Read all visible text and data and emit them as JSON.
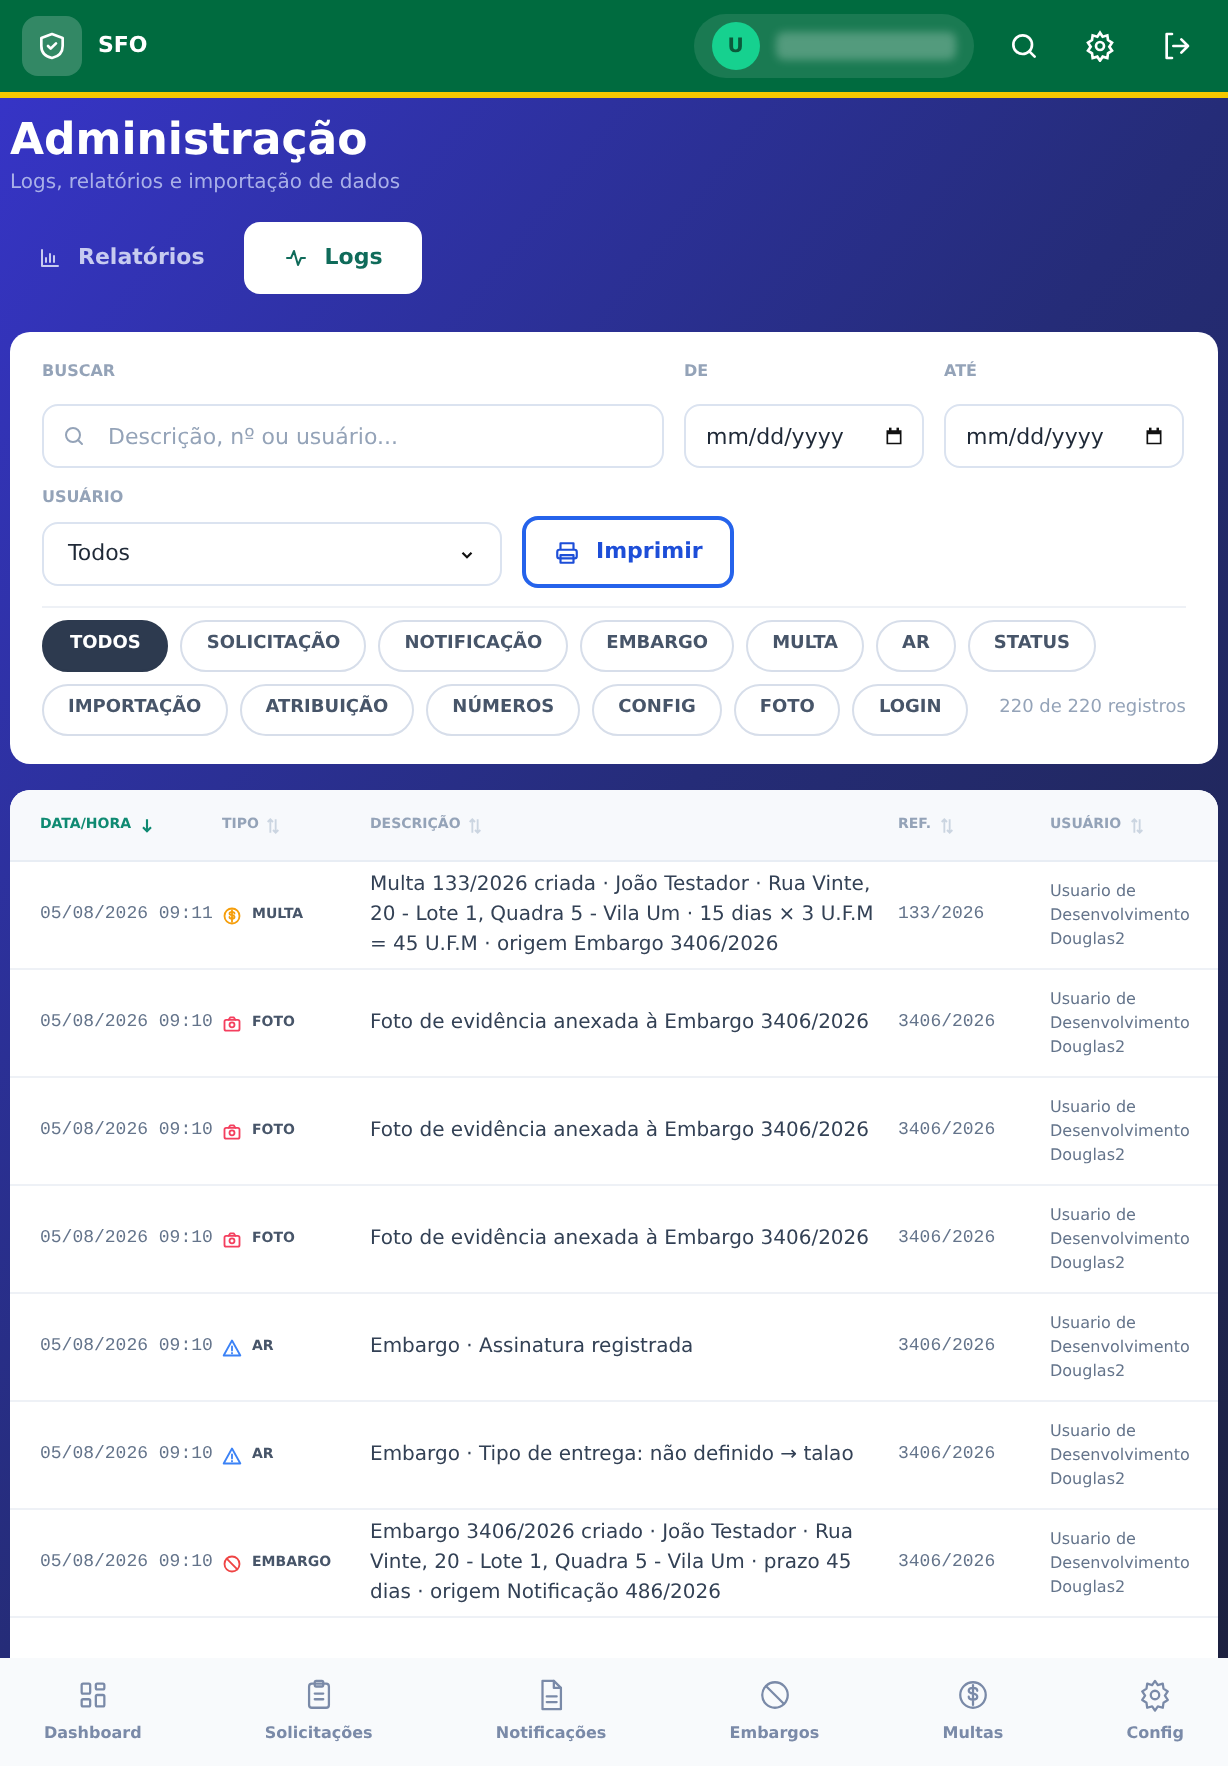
{
  "app": {
    "name": "SFO",
    "user_initial": "U"
  },
  "page": {
    "title": "Administração",
    "subtitle": "Logs, relatórios e importação de dados"
  },
  "tabs": [
    {
      "label": "Relatórios",
      "kind": "chart",
      "selected": false
    },
    {
      "label": "Logs",
      "kind": "activity",
      "selected": true
    }
  ],
  "filters": {
    "search_label": "BUSCAR",
    "search_placeholder": "Descrição, nº ou usuário...",
    "from_label": "DE",
    "from_placeholder": "mm/dd/yyyy",
    "to_label": "ATÉ",
    "to_placeholder": "mm/dd/yyyy",
    "user_label": "USUÁRIO",
    "user_value": "Todos",
    "print_button": "Imprimir",
    "count": "220 de 220 registros"
  },
  "chips": [
    {
      "label": "TODOS",
      "selected": true
    },
    {
      "label": "SOLICITAÇÃO",
      "selected": false
    },
    {
      "label": "NOTIFICAÇÃO",
      "selected": false
    },
    {
      "label": "EMBARGO",
      "selected": false
    },
    {
      "label": "MULTA",
      "selected": false
    },
    {
      "label": "AR",
      "selected": false
    },
    {
      "label": "STATUS",
      "selected": false
    },
    {
      "label": "IMPORTAÇÃO",
      "selected": false
    },
    {
      "label": "ATRIBUIÇÃO",
      "selected": false
    },
    {
      "label": "NÚMEROS",
      "selected": false
    },
    {
      "label": "CONFIG",
      "selected": false
    },
    {
      "label": "FOTO",
      "selected": false
    },
    {
      "label": "LOGIN",
      "selected": false
    }
  ],
  "table": {
    "columns": [
      {
        "label": "DATA/HORA",
        "selected": true
      },
      {
        "label": "TIPO",
        "selected": false
      },
      {
        "label": "DESCRIÇÃO",
        "selected": false
      },
      {
        "label": "REF.",
        "selected": false
      },
      {
        "label": "USUÁRIO",
        "selected": false
      }
    ],
    "rows": [
      {
        "datetime": "05/08/2026 09:11",
        "kind": "multa",
        "type": "MULTA",
        "description": "Multa 133/2026 criada · João Testador · Rua Vinte, 20 - Lote 1, Quadra 5 - Vila Um · 15 dias × 3 U.F.M = 45 U.F.M · origem Embargo 3406/2026",
        "ref": "133/2026",
        "user": "Usuario de Desenvolvimento Douglas2"
      },
      {
        "datetime": "05/08/2026 09:10",
        "kind": "foto",
        "type": "FOTO",
        "description": "Foto de evidência anexada à Embargo 3406/2026",
        "ref": "3406/2026",
        "user": "Usuario de Desenvolvimento Douglas2"
      },
      {
        "datetime": "05/08/2026 09:10",
        "kind": "foto",
        "type": "FOTO",
        "description": "Foto de evidência anexada à Embargo 3406/2026",
        "ref": "3406/2026",
        "user": "Usuario de Desenvolvimento Douglas2"
      },
      {
        "datetime": "05/08/2026 09:10",
        "kind": "foto",
        "type": "FOTO",
        "description": "Foto de evidência anexada à Embargo 3406/2026",
        "ref": "3406/2026",
        "user": "Usuario de Desenvolvimento Douglas2"
      },
      {
        "datetime": "05/08/2026 09:10",
        "kind": "ar",
        "type": "AR",
        "description": "Embargo · Assinatura registrada",
        "ref": "3406/2026",
        "user": "Usuario de Desenvolvimento Douglas2"
      },
      {
        "datetime": "05/08/2026 09:10",
        "kind": "ar",
        "type": "AR",
        "description": "Embargo · Tipo de entrega: não definido → talao",
        "ref": "3406/2026",
        "user": "Usuario de Desenvolvimento Douglas2"
      },
      {
        "datetime": "05/08/2026 09:10",
        "kind": "embargo",
        "type": "EMBARGO",
        "description": "Embargo 3406/2026 criado · João Testador · Rua Vinte, 20 - Lote 1, Quadra 5 - Vila Um · prazo 45 dias · origem Notificação 486/2026",
        "ref": "3406/2026",
        "user": "Usuario de Desenvolvimento Douglas2"
      }
    ]
  },
  "bottom_nav": [
    {
      "label": "Dashboard",
      "kind": "grid"
    },
    {
      "label": "Solicitações",
      "kind": "clipboard"
    },
    {
      "label": "Notificações",
      "kind": "document"
    },
    {
      "label": "Embargos",
      "kind": "ban"
    },
    {
      "label": "Multas",
      "kind": "dollar"
    },
    {
      "label": "Config",
      "kind": "gear"
    }
  ]
}
